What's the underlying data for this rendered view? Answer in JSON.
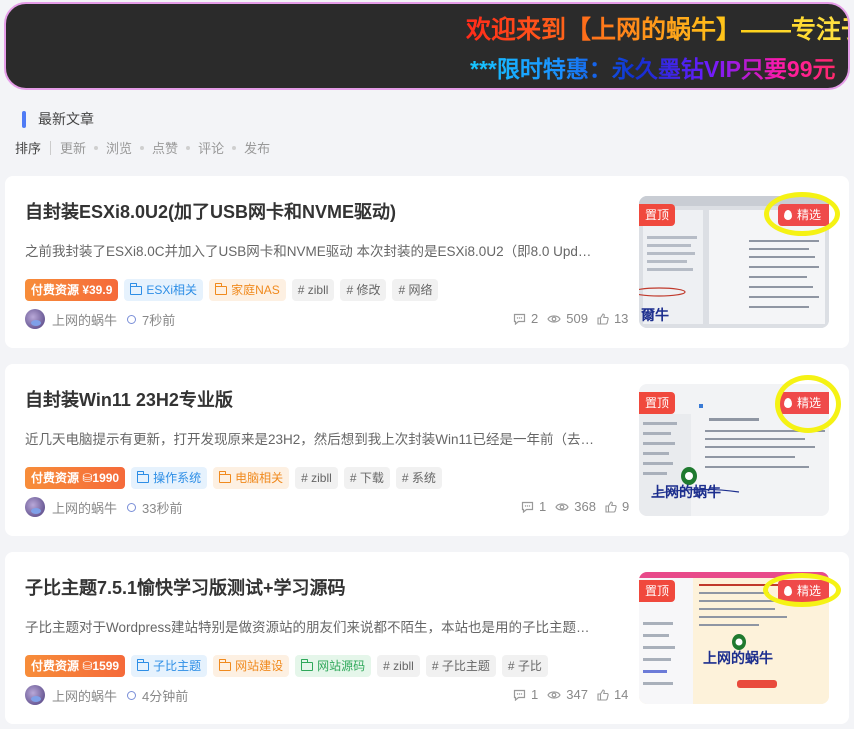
{
  "banner": {
    "line1": "欢迎来到【上网的蜗牛】——专注于",
    "line2": "***限时特惠：永久墨钻VIP只要99元"
  },
  "section": {
    "title": "最新文章"
  },
  "sort": {
    "label": "排序",
    "options": [
      "更新",
      "浏览",
      "点赞",
      "评论",
      "发布"
    ]
  },
  "colors": {
    "accent": "#4f7bf5",
    "price_tag": "#f56a3a",
    "hot_badge": "#ef4a4a",
    "highlight_ring": "#f5f214"
  },
  "posts": [
    {
      "title": "自封装ESXi8.0U2(加了USB网卡和NVME驱动)",
      "excerpt": "之前我封装了ESXi8.0C并加入了USB网卡和NVME驱动 本次封装的是ESXi8.0U2（即8.0 Upd…",
      "price_tag": "付费资源 ¥39.9",
      "tags": [
        {
          "label": "ESXi相关",
          "style": "blue",
          "icon": "folder-icon"
        },
        {
          "label": "家庭NAS",
          "style": "orange",
          "icon": "folder-icon"
        },
        {
          "label": "# zibll",
          "style": "gray"
        },
        {
          "label": "# 修改",
          "style": "gray"
        },
        {
          "label": "# 网络",
          "style": "gray"
        }
      ],
      "author": "上网的蜗牛",
      "time": "7秒前",
      "comments": "2",
      "views": "509",
      "likes": "13",
      "badge_top": "置顶",
      "badge_hot": "精选"
    },
    {
      "title": "自封装Win11 23H2专业版",
      "excerpt": "近几天电脑提示有更新，打开发现原来是23H2，然后想到我上次封装Win11已经是一年前（去…",
      "price_tag": "付费资源 ⛁1990",
      "tags": [
        {
          "label": "操作系统",
          "style": "blue",
          "icon": "folder-icon"
        },
        {
          "label": "电脑相关",
          "style": "orange",
          "icon": "folder-icon"
        },
        {
          "label": "# zibll",
          "style": "gray"
        },
        {
          "label": "# 下载",
          "style": "gray"
        },
        {
          "label": "# 系统",
          "style": "gray"
        }
      ],
      "author": "上网的蜗牛",
      "time": "33秒前",
      "comments": "1",
      "views": "368",
      "likes": "9",
      "badge_top": "置顶",
      "badge_hot": "精选",
      "thumb_caption": "上网的蜗牛"
    },
    {
      "title": "子比主题7.5.1愉快学习版测试+学习源码",
      "excerpt": "子比主题对于Wordpress建站特别是做资源站的朋友们来说都不陌生，本站也是用的子比主题…",
      "price_tag": "付费资源 ⛁1599",
      "tags": [
        {
          "label": "子比主题",
          "style": "blue",
          "icon": "folder-icon"
        },
        {
          "label": "网站建设",
          "style": "orange",
          "icon": "folder-icon"
        },
        {
          "label": "网站源码",
          "style": "green",
          "icon": "folder-icon"
        },
        {
          "label": "# zibll",
          "style": "gray"
        },
        {
          "label": "# 子比主题",
          "style": "gray"
        },
        {
          "label": "# 子比",
          "style": "gray"
        }
      ],
      "author": "上网的蜗牛",
      "time": "4分钟前",
      "comments": "1",
      "views": "347",
      "likes": "14",
      "badge_top": "置顶",
      "badge_hot": "精选",
      "thumb_caption": "上网的蜗牛"
    }
  ]
}
